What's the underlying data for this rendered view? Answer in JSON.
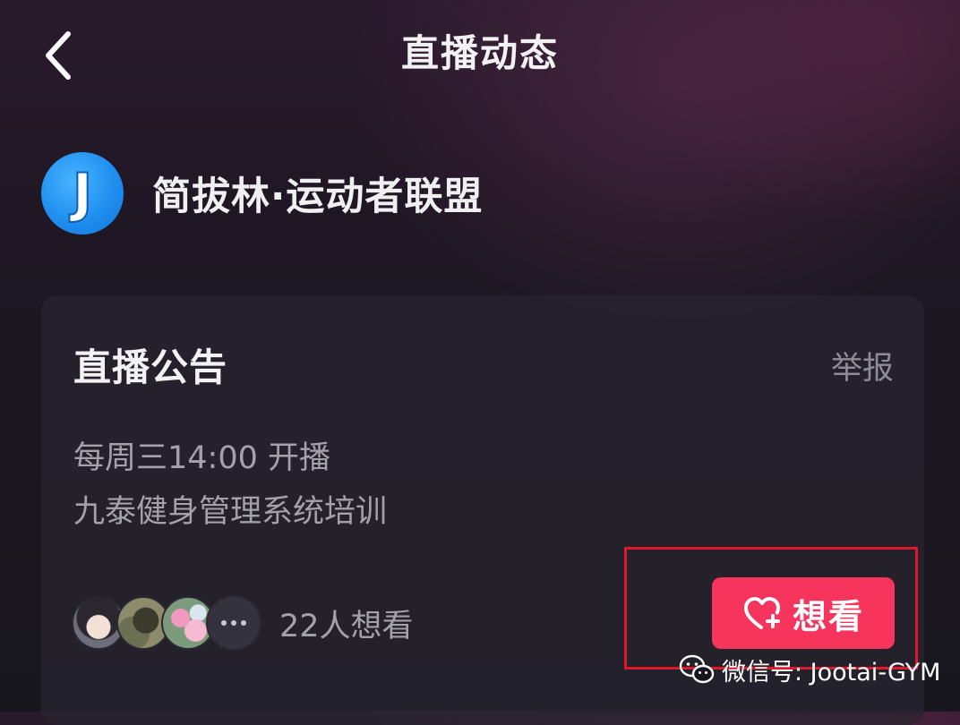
{
  "header": {
    "title": "直播动态",
    "back_icon": "chevron-left-icon"
  },
  "host": {
    "avatar_letter": "J",
    "name": "简拔林·运动者联盟"
  },
  "announcement": {
    "title": "直播公告",
    "report_label": "举报",
    "lines": [
      "每周三14:00 开播",
      "九泰健身管理系统培训"
    ]
  },
  "watchers": {
    "count_label": "22人想看",
    "more_icon": "more-dots-icon"
  },
  "want_button": {
    "label": "想看",
    "icon": "heart-plus-icon",
    "color": "#f7345b"
  },
  "watermark": {
    "text": "微信号: Jootai-GYM",
    "icon": "wechat-icon"
  },
  "colors": {
    "highlight": "#e0182c",
    "background": "#18161d"
  }
}
